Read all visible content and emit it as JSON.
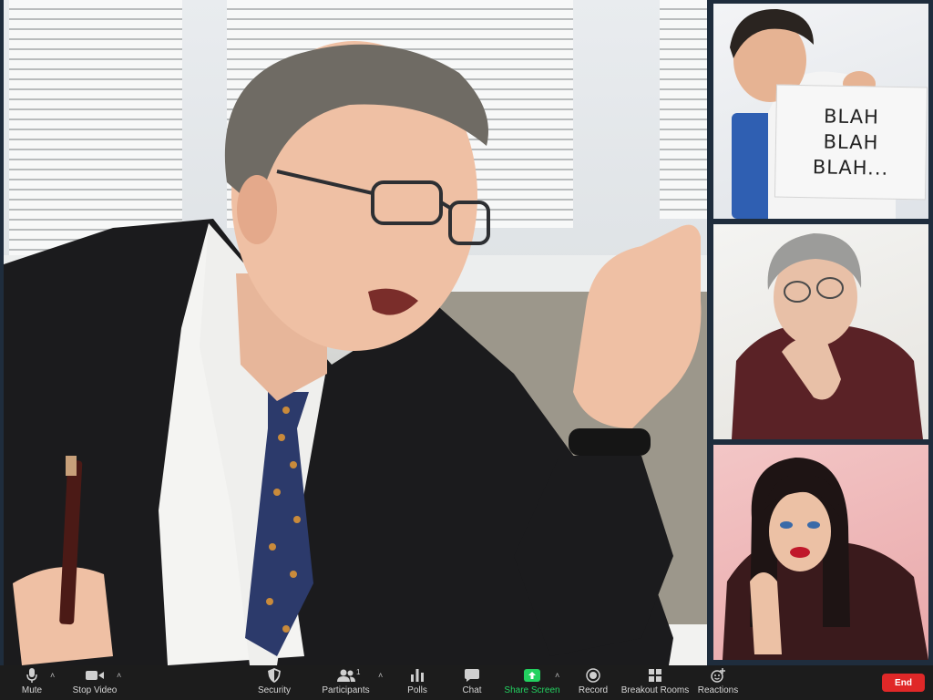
{
  "sign": {
    "line1": "BLAH",
    "line2": "BLAH",
    "line3": "BLAH..."
  },
  "toolbar": {
    "mute": "Mute",
    "stop_video": "Stop Video",
    "security": "Security",
    "participants": "Participants",
    "participants_count": "1",
    "polls": "Polls",
    "chat": "Chat",
    "share_screen": "Share Screen",
    "record": "Record",
    "breakout_rooms": "Breakout Rooms",
    "reactions": "Reactions",
    "end": "End"
  },
  "colors": {
    "toolbar_bg": "#1c1c1c",
    "share_green": "#23d160",
    "end_red": "#e02828",
    "tile_border": "#1f2d3d"
  },
  "icons": [
    "microphone-icon",
    "video-camera-icon",
    "shield-icon",
    "participants-icon",
    "polls-icon",
    "chat-bubble-icon",
    "share-arrow-icon",
    "record-icon",
    "breakout-grid-icon",
    "reaction-emoji-icon"
  ]
}
